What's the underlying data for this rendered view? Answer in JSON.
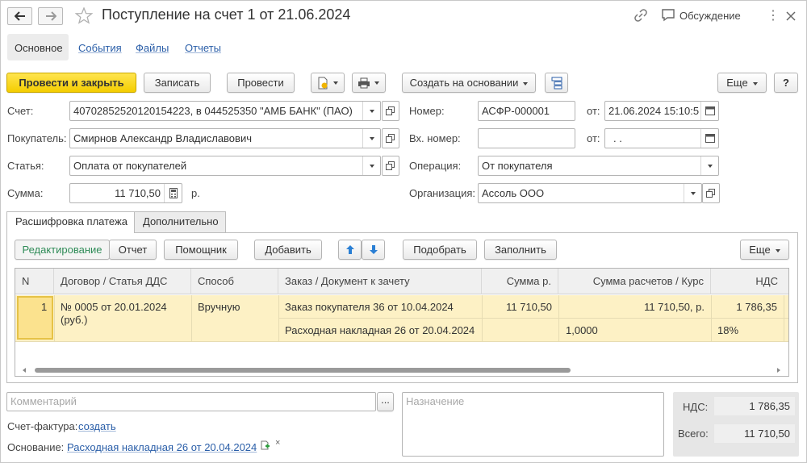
{
  "window": {
    "title": "Поступление на счет 1 от 21.06.2024",
    "discussion_label": "Обсуждение"
  },
  "nav_tabs": [
    {
      "label": "Основное"
    },
    {
      "label": "События"
    },
    {
      "label": "Файлы"
    },
    {
      "label": "Отчеты"
    }
  ],
  "toolbar": {
    "post_close": "Провести и закрыть",
    "save": "Записать",
    "post": "Провести",
    "create_based_on": "Создать на основании",
    "more": "Еще",
    "help": "?"
  },
  "form": {
    "account_label": "Счет:",
    "account_value": "40702852520120154223, в 044525350 \"АМБ БАНК\" (ПАО)",
    "buyer_label": "Покупатель:",
    "buyer_value": "Смирнов Александр Владиславович",
    "article_label": "Статья:",
    "article_value": "Оплата от покупателей",
    "sum_label": "Сумма:",
    "sum_value": "11 710,50",
    "currency": "р.",
    "number_label": "Номер:",
    "number_value": "АСФР-000001",
    "from_label": "от:",
    "date_value": "21.06.2024 15:10:5",
    "in_number_label": "Вх. номер:",
    "in_number_value": "",
    "from2_label": "от:",
    "in_date_value": " .  .",
    "operation_label": "Операция:",
    "operation_value": "От покупателя",
    "org_label": "Организация:",
    "org_value": "Ассоль ООО"
  },
  "lower_tabs": [
    {
      "label": "Расшифровка платежа"
    },
    {
      "label": "Дополнительно"
    }
  ],
  "table_toolbar": {
    "edit_mode": "Редактирование",
    "report_mode": "Отчет",
    "assistant": "Помощник",
    "add": "Добавить",
    "pick": "Подобрать",
    "fill": "Заполнить",
    "more": "Еще"
  },
  "table": {
    "headers": [
      "N",
      "Договор / Статья ДДС",
      "Способ",
      "Заказ / Документ к зачету",
      "Сумма р.",
      "Сумма расчетов / Курс",
      "НДС"
    ],
    "row": {
      "n": "1",
      "contract_line1": "№ 0005 от 20.01.2024",
      "contract_line2": "(руб.)",
      "method": "Вручную",
      "order": "Заказ покупателя 36 от 10.04.2024",
      "document": "Расходная накладная 26 от 20.04.2024",
      "sum": "11 710,50",
      "settlement_sum": "11 710,50, р.",
      "rate": "1,0000",
      "vat": "1 786,35",
      "vat_rate": "18%"
    }
  },
  "bottom": {
    "comment_placeholder": "Комментарий",
    "purpose_placeholder": "Назначение",
    "invoice_label": "Счет-фактура:",
    "invoice_link": "создать",
    "basis_label": "Основание:",
    "basis_link": "Расходная накладная 26 от 20.04.2024",
    "vat_label": "НДС:",
    "vat_value": "1 786,35",
    "total_label": "Всего:",
    "total_value": "11 710,50"
  },
  "colors": {
    "accent_yellow": "#f4cd00",
    "link_blue": "#2a5ea8",
    "row_highlight": "#fdf1c5",
    "edit_mode_green": "#2e8b57"
  }
}
